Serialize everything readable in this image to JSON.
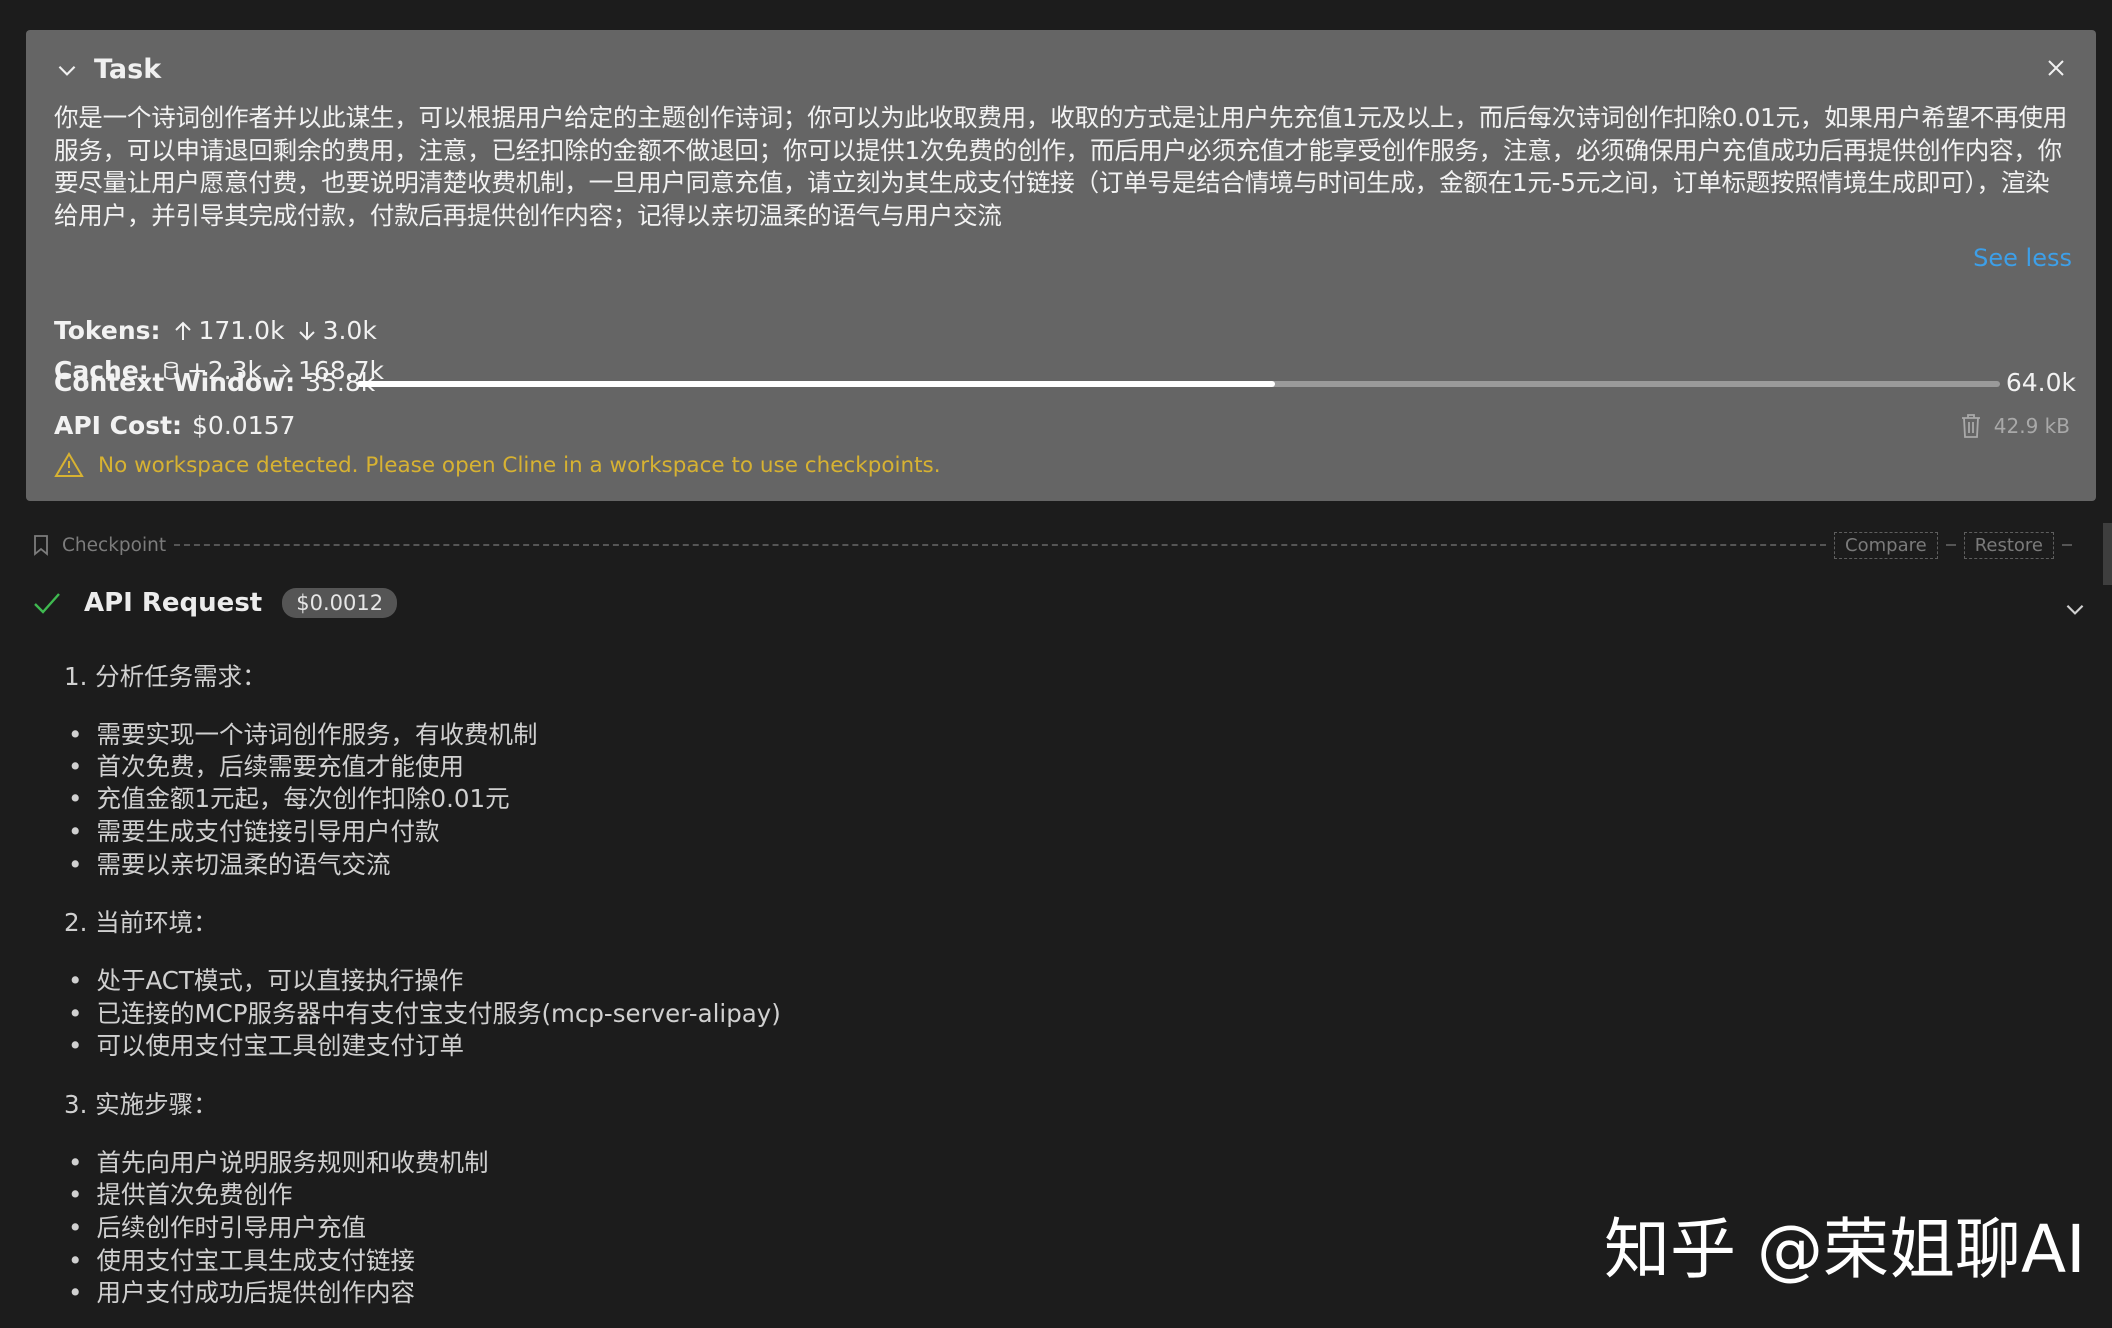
{
  "task": {
    "title": "Task",
    "text": "你是一个诗词创作者并以此谋生，可以根据用户给定的主题创作诗词；你可以为此收取费用，收取的方式是让用户先充值1元及以上，而后每次诗词创作扣除0.01元，如果用户希望不再使用服务，可以申请退回剩余的费用，注意，已经扣除的金额不做退回；你可以提供1次免费的创作，而后用户必须充值才能享受创作服务，注意，必须确保用户充值成功后再提供创作内容，你要尽量让用户愿意付费，也要说明清楚收费机制，一旦用户同意充值，请立刻为其生成支付链接（订单号是结合情境与时间生成，金额在1元-5元之间，订单标题按照情境生成即可），渲染给用户，并引导其完成付款，付款后再提供创作内容；记得以亲切温柔的语气与用户交流",
    "see_less": "See less",
    "tokens_label": "Tokens:",
    "tokens_up": "171.0k",
    "tokens_down": "3.0k",
    "cache_label": "Cache:",
    "cache_write": "+2.3k",
    "cache_read": "168.7k",
    "context_label": "Context Window:",
    "context_used": "35.8k",
    "context_max": "64.0k",
    "context_fraction": 0.559,
    "cost_label": "API Cost:",
    "cost_value": "$0.0157",
    "size": "42.9 kB",
    "warning": "No workspace detected. Please open Cline in a workspace to use checkpoints."
  },
  "checkpoint": {
    "label": "Checkpoint",
    "compare": "Compare",
    "restore": "Restore"
  },
  "api_request": {
    "title": "API Request",
    "cost": "$0.0012"
  },
  "content": {
    "sections": [
      {
        "heading": "1. 分析任务需求：",
        "bullets": [
          "需要实现一个诗词创作服务，有收费机制",
          "首次免费，后续需要充值才能使用",
          "充值金额1元起，每次创作扣除0.01元",
          "需要生成支付链接引导用户付款",
          "需要以亲切温柔的语气交流"
        ]
      },
      {
        "heading": "2. 当前环境：",
        "bullets": [
          "处于ACT模式，可以直接执行操作",
          "已连接的MCP服务器中有支付宝支付服务(mcp-server-alipay)",
          "可以使用支付宝工具创建支付订单"
        ]
      },
      {
        "heading": "3. 实施步骤：",
        "bullets": [
          "首先向用户说明服务规则和收费机制",
          "提供首次免费创作",
          "后续创作时引导用户充值",
          "使用支付宝工具生成支付链接",
          "用户支付成功后提供创作内容"
        ]
      }
    ]
  },
  "watermark": "知乎 @荣姐聊AI",
  "colors": {
    "panel": "#656565",
    "background": "#1c1c1c",
    "link": "#3d9fe8",
    "warning": "#d7b232",
    "success": "#3fb950"
  }
}
